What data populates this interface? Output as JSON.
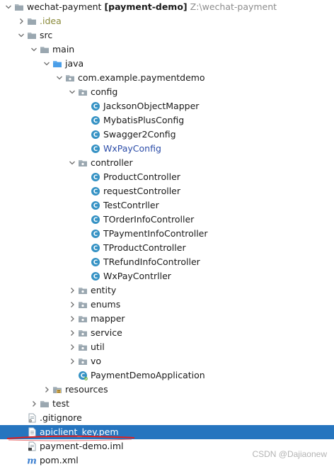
{
  "root": {
    "name": "wechat-payment",
    "module": "[payment-demo]",
    "path": "Z:\\wechat-payment"
  },
  "tree": [
    {
      "label": "wechat-payment",
      "depth": 0,
      "kind": "root",
      "arrow": "open"
    },
    {
      "label": ".idea",
      "depth": 1,
      "kind": "folder",
      "arrow": "closed",
      "muted": true
    },
    {
      "label": "src",
      "depth": 1,
      "kind": "folder",
      "arrow": "open"
    },
    {
      "label": "main",
      "depth": 2,
      "kind": "folder",
      "arrow": "open"
    },
    {
      "label": "java",
      "depth": 3,
      "kind": "folder-blue",
      "arrow": "open"
    },
    {
      "label": "com.example.paymentdemo",
      "depth": 4,
      "kind": "package",
      "arrow": "open"
    },
    {
      "label": "config",
      "depth": 5,
      "kind": "package",
      "arrow": "open"
    },
    {
      "label": "JacksonObjectMapper",
      "depth": 6,
      "kind": "class"
    },
    {
      "label": "MybatisPlusConfig",
      "depth": 6,
      "kind": "class"
    },
    {
      "label": "Swagger2Config",
      "depth": 6,
      "kind": "class"
    },
    {
      "label": "WxPayConfig",
      "depth": 6,
      "kind": "class",
      "blue": true
    },
    {
      "label": "controller",
      "depth": 5,
      "kind": "package",
      "arrow": "open"
    },
    {
      "label": "ProductController",
      "depth": 6,
      "kind": "class"
    },
    {
      "label": "requestController",
      "depth": 6,
      "kind": "class"
    },
    {
      "label": "TestContrller",
      "depth": 6,
      "kind": "class"
    },
    {
      "label": "TOrderInfoController",
      "depth": 6,
      "kind": "class"
    },
    {
      "label": "TPaymentInfoController",
      "depth": 6,
      "kind": "class"
    },
    {
      "label": "TProductController",
      "depth": 6,
      "kind": "class"
    },
    {
      "label": "TRefundInfoController",
      "depth": 6,
      "kind": "class"
    },
    {
      "label": "WxPayContrller",
      "depth": 6,
      "kind": "class"
    },
    {
      "label": "entity",
      "depth": 5,
      "kind": "package",
      "arrow": "closed"
    },
    {
      "label": "enums",
      "depth": 5,
      "kind": "package",
      "arrow": "closed"
    },
    {
      "label": "mapper",
      "depth": 5,
      "kind": "package",
      "arrow": "closed"
    },
    {
      "label": "service",
      "depth": 5,
      "kind": "package",
      "arrow": "closed"
    },
    {
      "label": "util",
      "depth": 5,
      "kind": "package",
      "arrow": "closed"
    },
    {
      "label": "vo",
      "depth": 5,
      "kind": "package",
      "arrow": "closed"
    },
    {
      "label": "PaymentDemoApplication",
      "depth": 5,
      "kind": "app-class"
    },
    {
      "label": "resources",
      "depth": 3,
      "kind": "folder-res",
      "arrow": "closed"
    },
    {
      "label": "test",
      "depth": 2,
      "kind": "folder",
      "arrow": "closed"
    },
    {
      "label": ".gitignore",
      "depth": 1,
      "kind": "file-ignore"
    },
    {
      "label": "apiclient_key.pem",
      "depth": 1,
      "kind": "file-text",
      "selected": true
    },
    {
      "label": "payment-demo.iml",
      "depth": 1,
      "kind": "file-iml"
    },
    {
      "label": "pom.xml",
      "depth": 1,
      "kind": "maven"
    }
  ],
  "icons": {
    "root": "folder-module-icon",
    "folder": "folder-icon",
    "folder-blue": "source-folder-icon",
    "folder-res": "resources-folder-icon",
    "package": "package-icon",
    "class": "java-class-icon",
    "app-class": "spring-boot-class-icon",
    "file-ignore": "gitignore-file-icon",
    "file-text": "text-file-icon",
    "file-iml": "module-file-icon",
    "maven": "maven-icon"
  },
  "colors": {
    "selection": "#2675bf",
    "folder": "#aeb9c0",
    "source_folder": "#4a9ee8",
    "class_icon": "#3592c4",
    "annotation_underline": "#e02020"
  },
  "watermark": "CSDN @Dajiaonew"
}
